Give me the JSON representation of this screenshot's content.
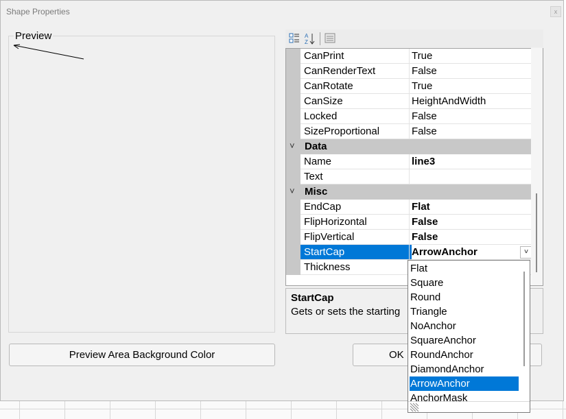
{
  "window": {
    "title": "Shape Properties",
    "close_glyph": "x"
  },
  "preview": {
    "label": "Preview"
  },
  "toolbar": {
    "icons": [
      "categorized-icon",
      "alphabetical-sort-icon",
      "property-pages-icon"
    ]
  },
  "grid": {
    "rows_top": [
      {
        "name": "CanPrint",
        "value": "True"
      },
      {
        "name": "CanRenderText",
        "value": "False"
      },
      {
        "name": "CanRotate",
        "value": "True"
      },
      {
        "name": "CanSize",
        "value": "HeightAndWidth"
      },
      {
        "name": "Locked",
        "value": "False"
      },
      {
        "name": "SizeProportional",
        "value": "False"
      }
    ],
    "cat_data": {
      "chevron": "˅",
      "label": "Data"
    },
    "rows_data": [
      {
        "name": "Name",
        "value": "line3"
      },
      {
        "name": "Text",
        "value": ""
      }
    ],
    "cat_misc": {
      "chevron": "˅",
      "label": "Misc"
    },
    "rows_misc": [
      {
        "name": "EndCap",
        "value": "Flat"
      },
      {
        "name": "FlipHorizontal",
        "value": "False"
      },
      {
        "name": "FlipVertical",
        "value": "False"
      },
      {
        "name": "StartCap",
        "value": "ArrowAnchor"
      },
      {
        "name": "Thickness",
        "value": ""
      }
    ],
    "dropdown_arrow": "˅"
  },
  "help": {
    "title": "StartCap",
    "description": "Gets or sets the starting"
  },
  "buttons": {
    "bg_color": "Preview Area Background Color",
    "ok": "OK"
  },
  "dropdown": {
    "items": [
      "Flat",
      "Square",
      "Round",
      "Triangle",
      "NoAnchor",
      "SquareAnchor",
      "RoundAnchor",
      "DiamondAnchor",
      "ArrowAnchor",
      "AnchorMask"
    ],
    "selected": "ArrowAnchor"
  },
  "colors": {
    "selection": "#0078d7",
    "category": "#c8c8c8"
  }
}
